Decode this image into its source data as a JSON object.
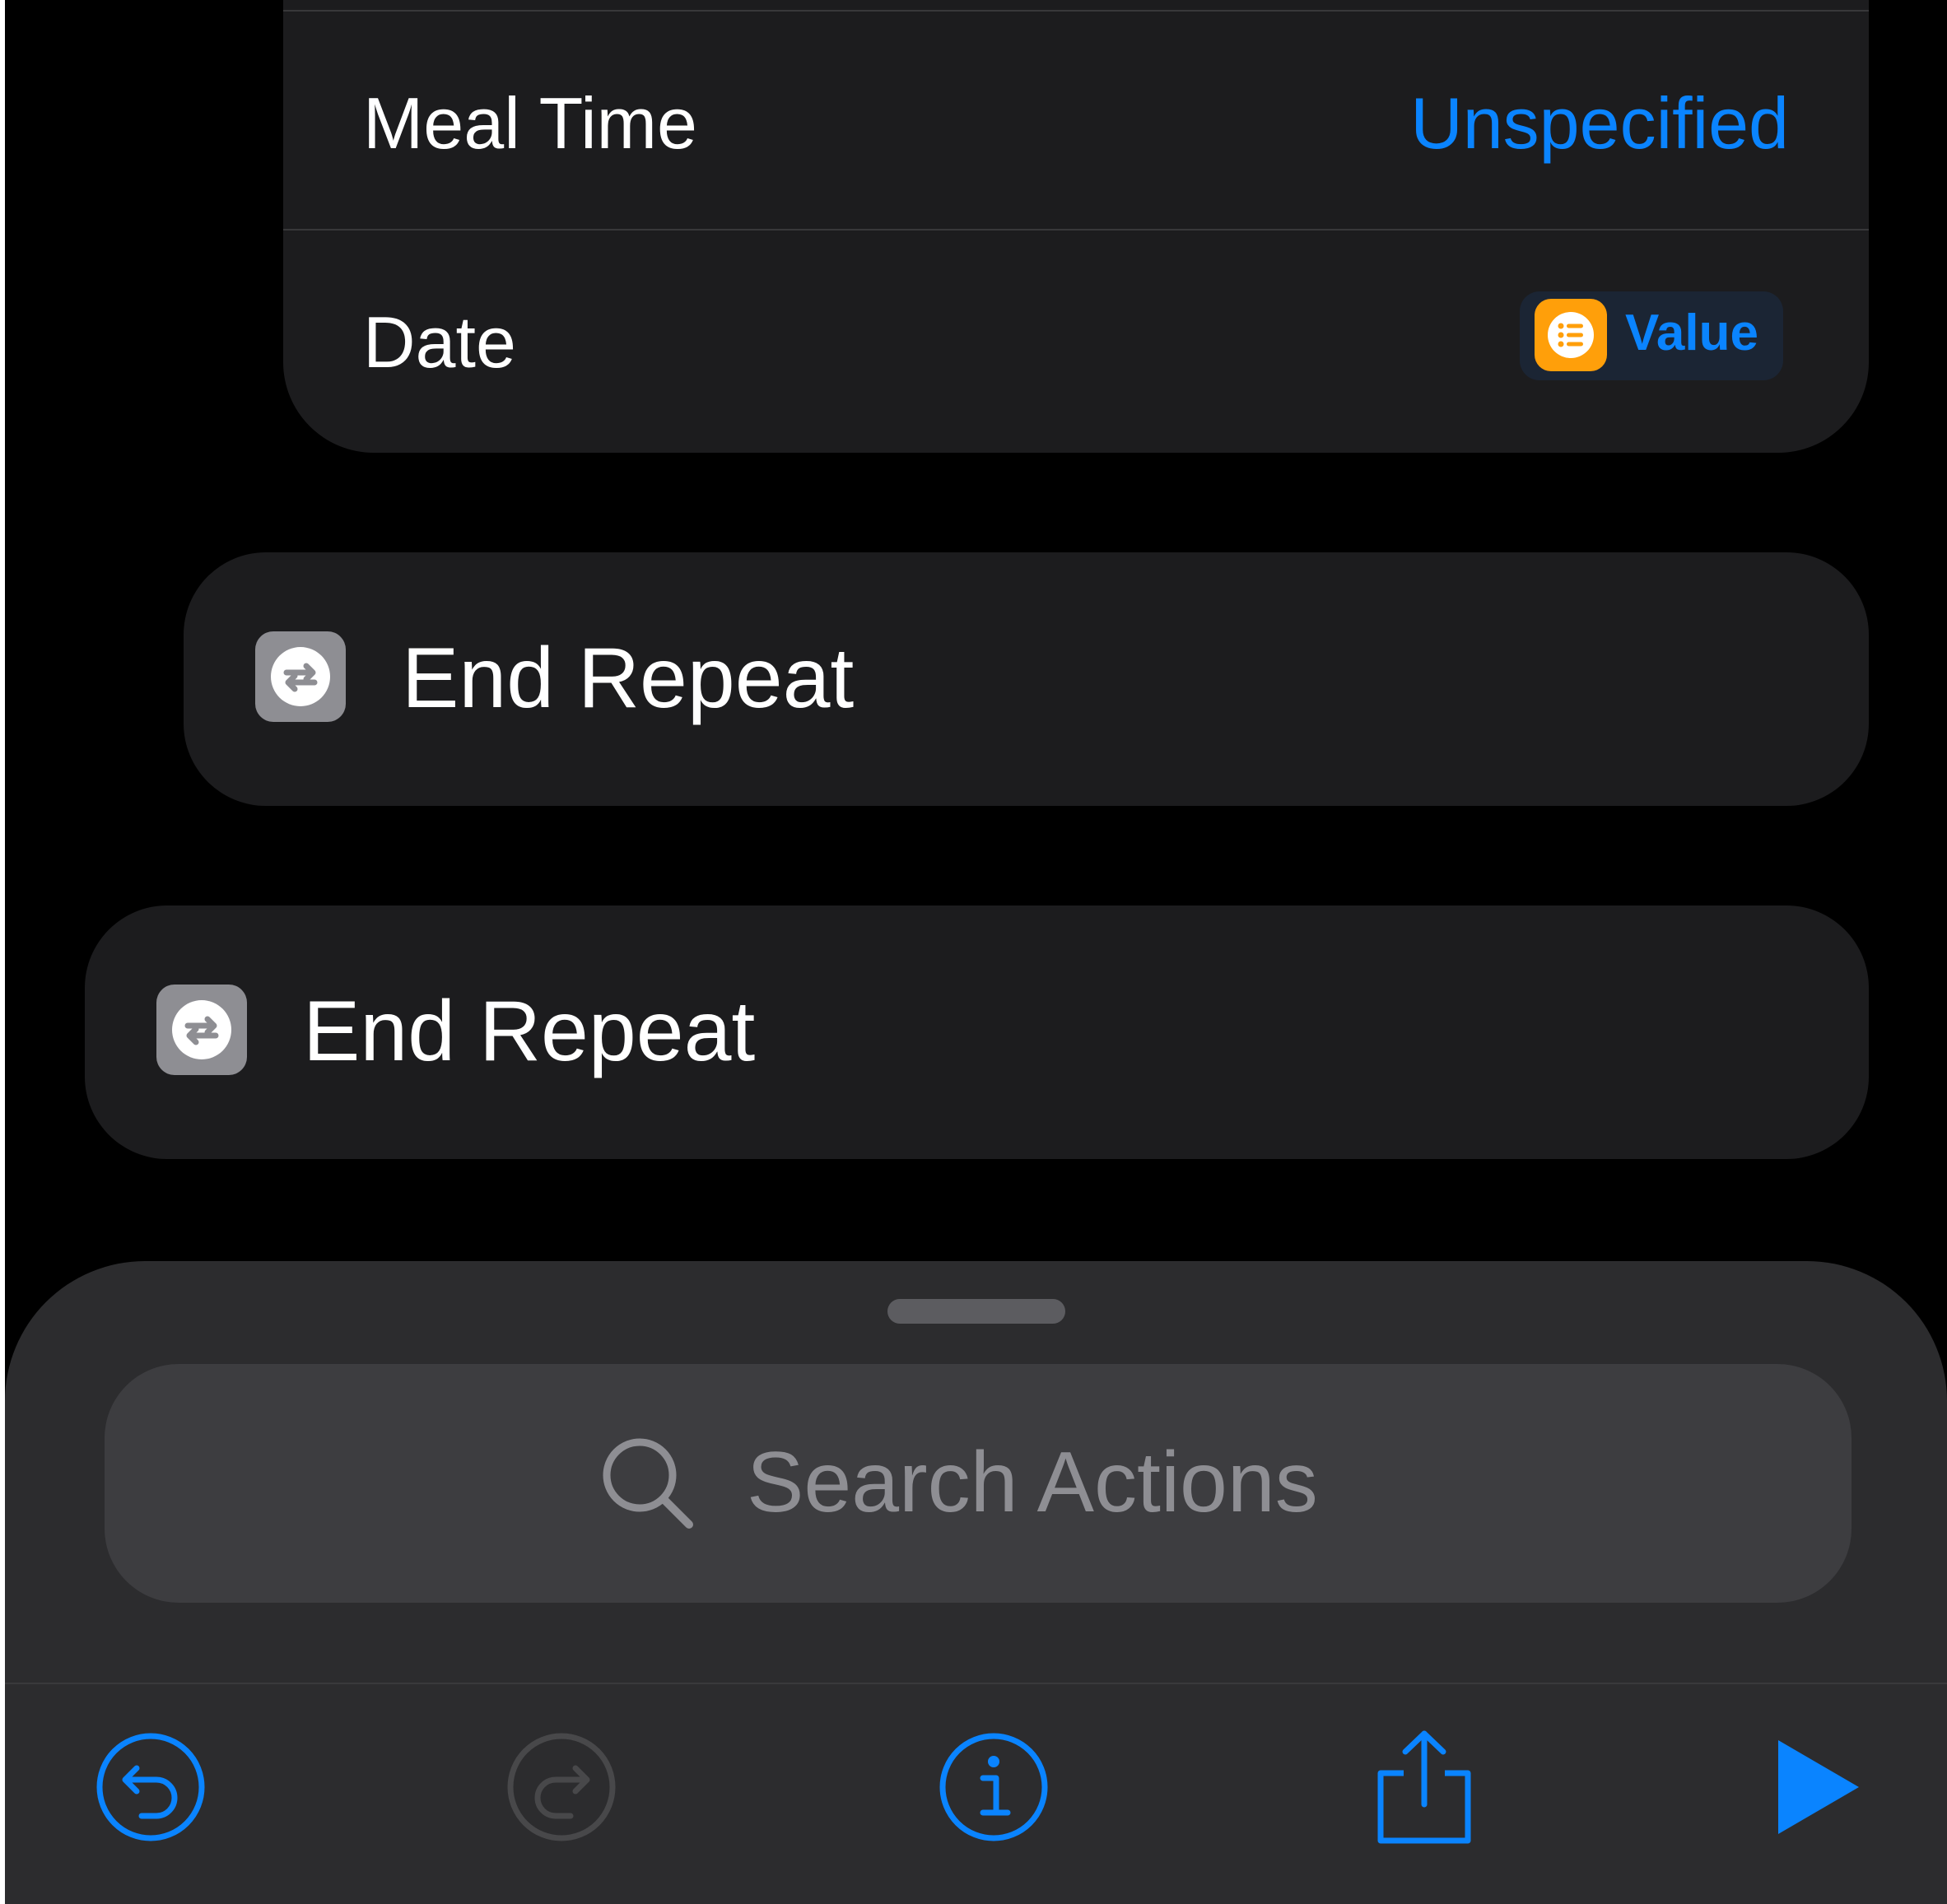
{
  "params": [
    {
      "label": "Meal Time",
      "value": "Unspecified"
    },
    {
      "label": "Date",
      "chip": {
        "label": "Value",
        "icon": "list-icon"
      }
    }
  ],
  "actions": [
    {
      "title": "End Repeat",
      "icon": "repeat-icon"
    },
    {
      "title": "End Repeat",
      "icon": "repeat-icon"
    }
  ],
  "search": {
    "placeholder": "Search Actions",
    "icon": "search-icon"
  },
  "toolbar": {
    "items": [
      "undo-icon",
      "redo-icon",
      "info-icon",
      "share-icon",
      "play-icon"
    ]
  },
  "colors": {
    "accent": "#0a84ff",
    "chip_icon": "#ff9f0a",
    "action_icon_bg": "#8e8e93",
    "card_bg": "#1c1c1e",
    "sheet_bg": "#2c2c2e",
    "redo_disabled": "#48484a"
  }
}
